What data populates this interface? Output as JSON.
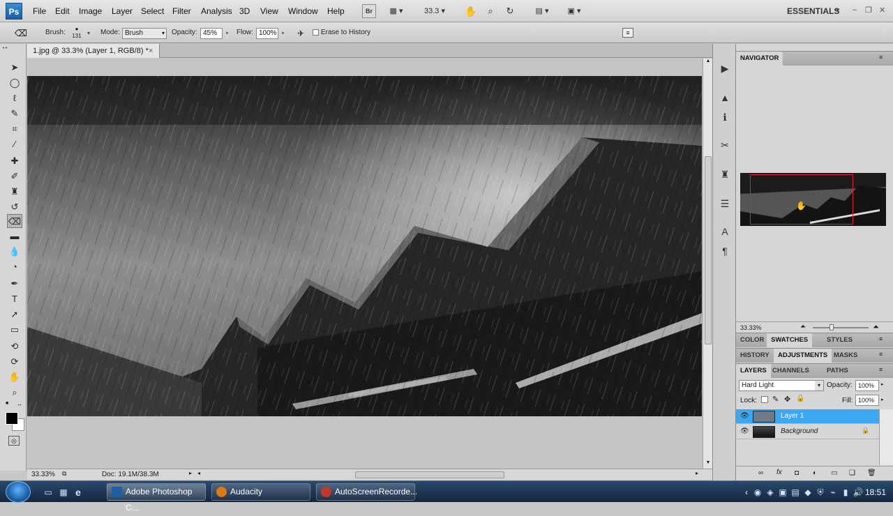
{
  "menubar": {
    "logo": "Ps",
    "items": [
      "File",
      "Edit",
      "Image",
      "Layer",
      "Select",
      "Filter",
      "Analysis",
      "3D",
      "View",
      "Window",
      "Help"
    ],
    "bridge_label": "Br",
    "zoom_value": "33.3",
    "workspace": "ESSENTIALS"
  },
  "options": {
    "brush_label": "Brush:",
    "brush_size": "131",
    "mode_label": "Mode:",
    "mode_value": "Brush",
    "opacity_label": "Opacity:",
    "opacity_value": "45%",
    "flow_label": "Flow:",
    "flow_value": "100%",
    "erase_history_label": "Erase to History"
  },
  "document": {
    "tab_title": "1.jpg @ 33.3% (Layer 1, RGB/8) *",
    "tab_close": "×",
    "zoom": "33.33%",
    "doc_size": "Doc: 19.1M/38.3M"
  },
  "panels": {
    "navigator_title": "NAVIGATOR",
    "nav_zoom": "33.33%",
    "tabs_row1": [
      "COLOR",
      "SWATCHES",
      "STYLES"
    ],
    "tabs_row2": [
      "HISTORY",
      "ADJUSTMENTS",
      "MASKS"
    ],
    "tabs_row3": [
      "LAYERS",
      "CHANNELS",
      "PATHS"
    ],
    "blend_mode": "Hard Light",
    "opacity_label": "Opacity:",
    "opacity_value": "100%",
    "lock_label": "Lock:",
    "fill_label": "Fill:",
    "fill_value": "100%",
    "layers": [
      {
        "name": "Layer 1"
      },
      {
        "name": "Background"
      }
    ]
  },
  "taskbar": {
    "buttons": [
      "Adobe Photoshop C...",
      "Audacity",
      "AutoScreenRecorde..."
    ],
    "time": "18:51"
  },
  "colors": {
    "selection": "#3aa8f2",
    "nav_box": "#e0203a",
    "ps_blue": "#1d5ea3"
  }
}
